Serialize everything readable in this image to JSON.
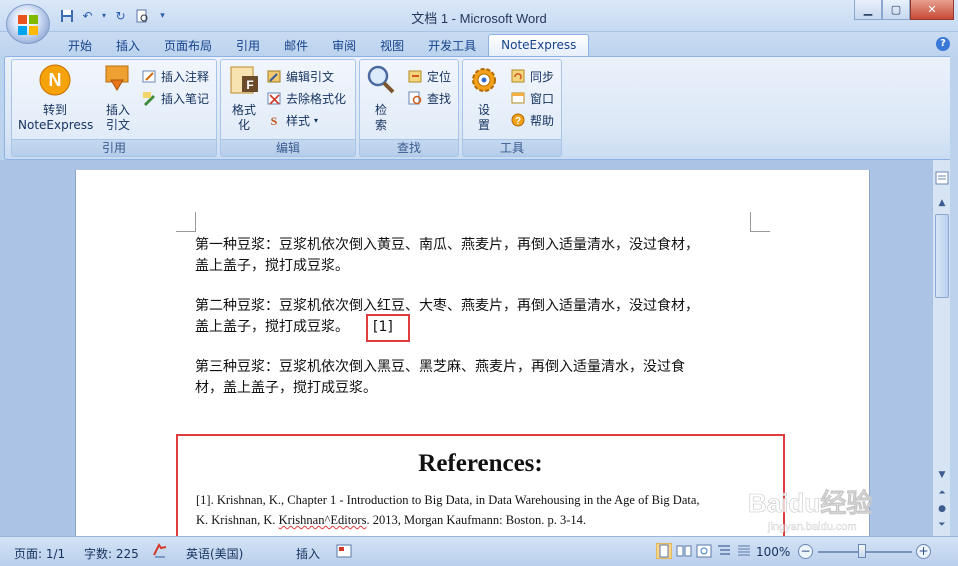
{
  "window": {
    "title": "文档 1 - Microsoft Word"
  },
  "tabs": [
    "开始",
    "插入",
    "页面布局",
    "引用",
    "邮件",
    "审阅",
    "视图",
    "开发工具",
    "NoteExpress"
  ],
  "active_tab": "NoteExpress",
  "ribbon": {
    "groups": {
      "cite": {
        "label": "引用",
        "goto": "转到\nNoteExpress",
        "goto_l1": "转到",
        "goto_l2": "NoteExpress",
        "insert_l1": "插入",
        "insert_l2": "引文",
        "insert_note": "插入注释",
        "insert_memo": "插入笔记"
      },
      "edit": {
        "label": "编辑",
        "format_l1": "格式",
        "format_l2": "化",
        "edit_cite": "编辑引文",
        "remove_format": "去除格式化",
        "style": "样式"
      },
      "find": {
        "label": "查找",
        "search_l1": "检",
        "search_l2": "索",
        "locate": "定位",
        "find": "查找"
      },
      "tools": {
        "label": "工具",
        "settings_l1": "设",
        "settings_l2": "置",
        "sync": "同步",
        "window": "窗口",
        "help": "帮助"
      }
    }
  },
  "document": {
    "p1_l1": "第一种豆浆：豆浆机依次倒入黄豆、南瓜、燕麦片，再倒入适量清水，没过食材，",
    "p1_l2": "盖上盖子，搅打成豆浆。",
    "p2_l1": "第二种豆浆：豆浆机依次倒入红豆、大枣、燕麦片，再倒入适量清水，没过食材，",
    "p2_l2": "盖上盖子，搅打成豆浆。",
    "citation": "[1]",
    "p3_l1": "第三种豆浆：豆浆机依次倒入黑豆、黑芝麻、燕麦片，再倒入适量清水，没过食",
    "p3_l2": "材，盖上盖子，搅打成豆浆。",
    "references_title": "References:",
    "ref1_l1": "[1].   Krishnan, K., Chapter 1 - Introduction to Big Data, in Data Warehousing in the Age of Big Data,",
    "ref1_l2a": "K. Krishnan, K. ",
    "ref1_l2b": "Krishnan^Editors",
    "ref1_l2c": ". 2013, Morgan Kaufmann: Boston. p. 3-14."
  },
  "status": {
    "page": "页面: 1/1",
    "words": "字数: 225",
    "language": "英语(美国)",
    "mode": "插入",
    "zoom": "100%"
  },
  "watermark": {
    "text": "Baidu经验",
    "sub": "jingyan.baidu.com"
  },
  "colors": {
    "highlight_box": "#e03c3c",
    "ribbon_text": "#15428b"
  }
}
